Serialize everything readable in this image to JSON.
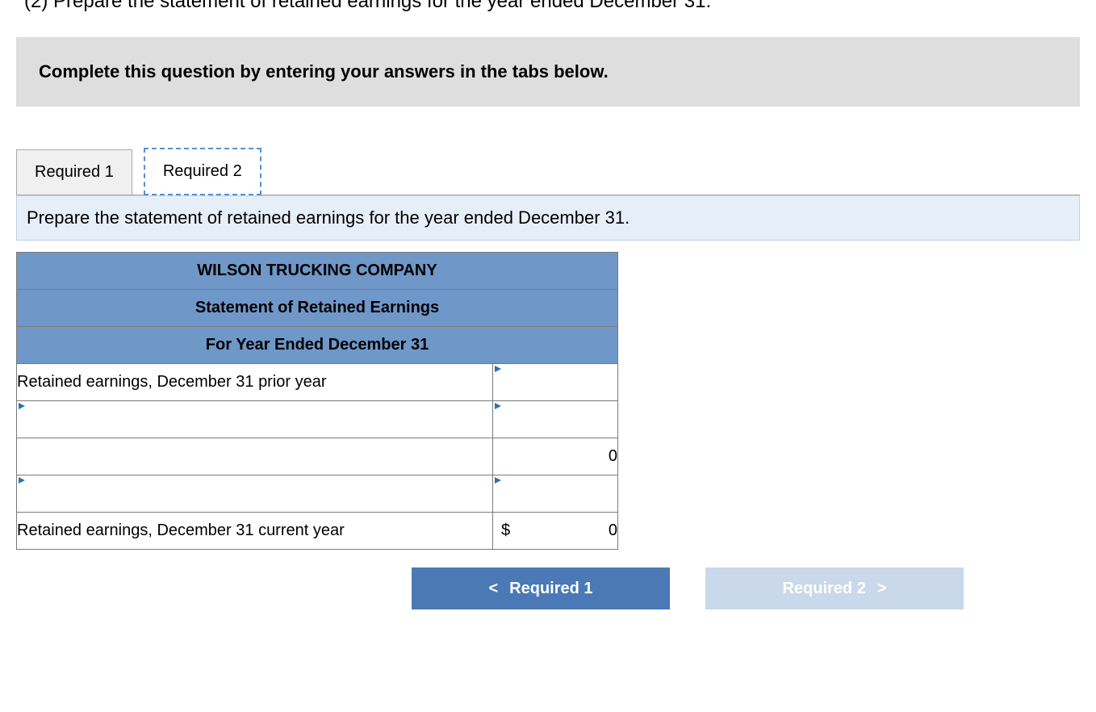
{
  "topline": "(2) Prepare the statement of retained earnings for the year ended December 31.",
  "instruction": "Complete this question by entering your answers in the tabs below.",
  "tabs": {
    "t1": "Required 1",
    "t2": "Required 2"
  },
  "subprompt": "Prepare the statement of retained earnings for the year ended December 31.",
  "sheet": {
    "h1": "WILSON TRUCKING COMPANY",
    "h2": "Statement of Retained Earnings",
    "h3": "For Year Ended December 31",
    "r1_label": "Retained earnings, December 31 prior year",
    "r1_val": "",
    "r2_label": "",
    "r2_val": "",
    "r3_label": "",
    "r3_val": "0",
    "r4_label": "",
    "r4_val": "",
    "r5_label": "Retained earnings, December 31 current year",
    "r5_cur": "$",
    "r5_val": "0"
  },
  "nav": {
    "prev_chev": "<",
    "prev": "Required 1",
    "next": "Required 2",
    "next_chev": ">"
  }
}
